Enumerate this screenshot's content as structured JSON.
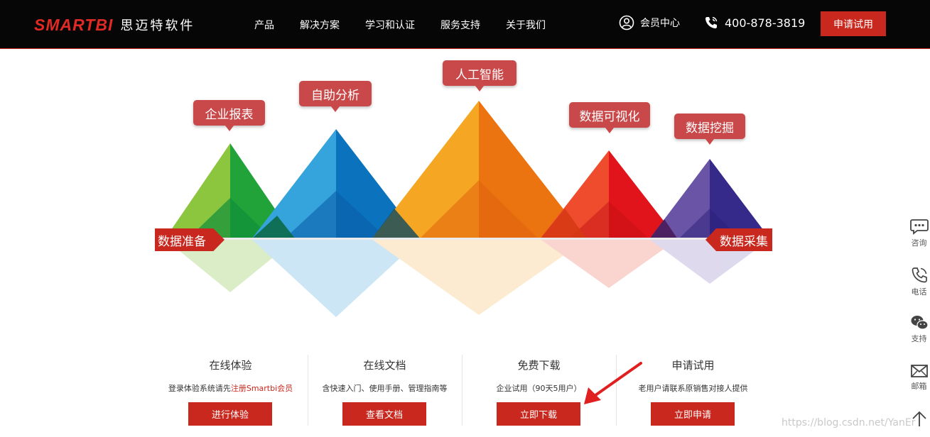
{
  "header": {
    "logo_mark": "SMARTBI",
    "logo_cn": "思迈特软件",
    "nav": [
      "产品",
      "解决方案",
      "学习和认证",
      "服务支持",
      "关于我们"
    ],
    "member_label": "会员中心",
    "phone": "400-878-3819",
    "trial_button": "申请试用"
  },
  "hero": {
    "callouts": [
      "企业报表",
      "自助分析",
      "人工智能",
      "数据可视化",
      "数据挖掘"
    ],
    "left_tag": "数据准备",
    "right_tag": "数据采集"
  },
  "features": [
    {
      "title": "在线体验",
      "desc_pre": "登录体验系统请先",
      "desc_link": "注册Smartbi会员",
      "button": "进行体验"
    },
    {
      "title": "在线文档",
      "desc_pre": "含快速入门、使用手册、管理指南等",
      "desc_link": "",
      "button": "查看文档"
    },
    {
      "title": "免费下载",
      "desc_pre": "企业试用（90天5用户）",
      "desc_link": "",
      "button": "立即下载"
    },
    {
      "title": "申请试用",
      "desc_pre": "老用户请联系原销售对接人提供",
      "desc_link": "",
      "button": "立即申请"
    }
  ],
  "sidebar": [
    {
      "label": "咨询",
      "icon": "chat-icon"
    },
    {
      "label": "电话",
      "icon": "phone-icon"
    },
    {
      "label": "支持",
      "icon": "wechat-icon"
    },
    {
      "label": "邮箱",
      "icon": "mail-icon"
    }
  ],
  "watermark": "https://blog.csdn.net/YanEr",
  "colors": {
    "header_bg": "#060606",
    "brand_red": "#c8281e",
    "callout": "#c9484a",
    "green": "#22a33a",
    "blue": "#1487d0",
    "orange": "#ef8a12",
    "red": "#e5201e",
    "purple": "#3a2a8c"
  }
}
